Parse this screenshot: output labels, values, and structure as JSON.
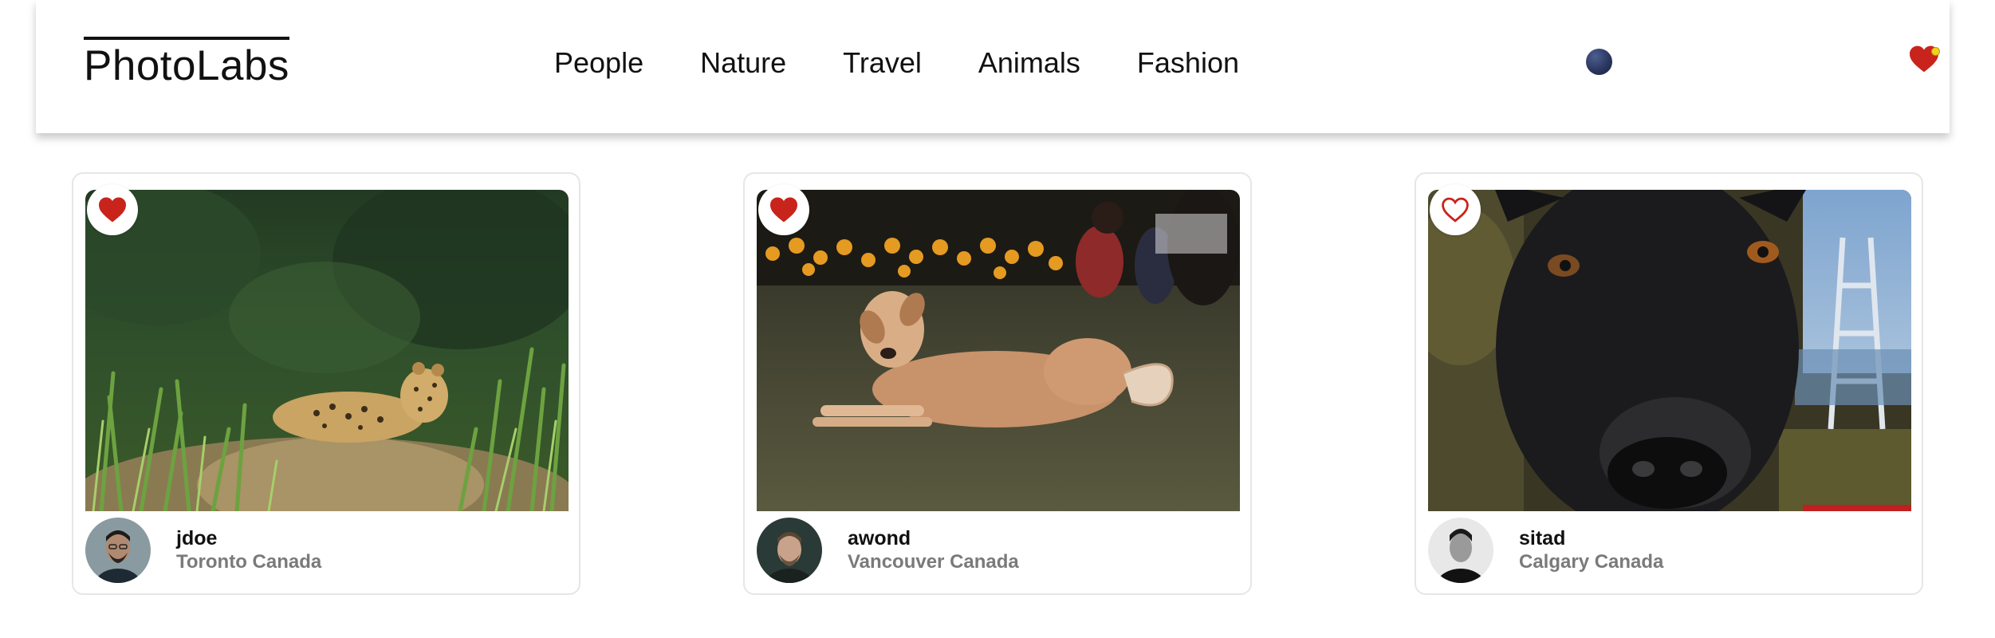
{
  "app": {
    "logo": "PhotoLabs"
  },
  "nav": {
    "topics": [
      "People",
      "Nature",
      "Travel",
      "Animals",
      "Fashion"
    ],
    "fav_notification": true
  },
  "colors": {
    "heart": "#c8241c",
    "notification": "#f3d21c",
    "dark_toggle": "#2a3760"
  },
  "photos": [
    {
      "subject": "jaguar lying in grass",
      "favorited": true,
      "username": "jdoe",
      "location": "Toronto Canada"
    },
    {
      "subject": "tan dog lying on grass",
      "favorited": true,
      "username": "awond",
      "location": "Vancouver Canada"
    },
    {
      "subject": "close-up of black dog face",
      "favorited": false,
      "username": "sitad",
      "location": "Calgary Canada"
    }
  ]
}
